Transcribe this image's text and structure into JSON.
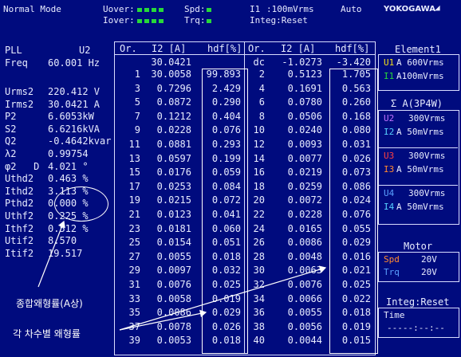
{
  "header": {
    "mode": "Normal Mode",
    "uover": "Uover:",
    "iover": "Iover:",
    "spd": "Spd:",
    "trq": "Trq:",
    "i1": "I1",
    "range": ":100mVrms",
    "auto": "Auto",
    "brand": "YOKOGAWA",
    "integ": "Integ:Reset"
  },
  "left": {
    "pll": "PLL",
    "pll_val": "U2",
    "freq": "Freq",
    "freq_val": "60.001 Hz",
    "rows": [
      {
        "label": "Urms2",
        "value": "220.412 V"
      },
      {
        "label": "Irms2",
        "value": "30.0421 A"
      },
      {
        "label": "P2",
        "value": "6.6053kW"
      },
      {
        "label": "S2",
        "value": "6.6216kVA"
      },
      {
        "label": "Q2",
        "value": "-0.4642kvar"
      },
      {
        "label": "λ2",
        "value": "0.99754"
      },
      {
        "label": "φ2   D",
        "value": "4.021 °"
      },
      {
        "label": "Uthd2",
        "value": "0.463 %"
      },
      {
        "label": "Ithd2",
        "value": "3.113 %"
      },
      {
        "label": "Pthd2",
        "value": "0.000 %"
      },
      {
        "label": "Uthf2",
        "value": "0.225 %"
      },
      {
        "label": "Ithf2",
        "value": "0.512 %"
      },
      {
        "label": "Utif2",
        "value": "8.570"
      },
      {
        "label": "Itif2",
        "value": "19.517"
      }
    ]
  },
  "table": {
    "headers": [
      "Or.",
      "I2 [A]",
      "hdf[%]",
      "Or.",
      "I2 [A]",
      "hdf[%]"
    ],
    "total_row": {
      "or1": "",
      "i1": "30.0421",
      "h1": "",
      "or2": "dc",
      "i2": "-1.0273",
      "h2": "-3.420"
    },
    "rows": [
      [
        "1",
        "30.0058",
        "99.893",
        "2",
        "0.5123",
        "1.705"
      ],
      [
        "3",
        "0.7296",
        "2.429",
        "4",
        "0.1691",
        "0.563"
      ],
      [
        "5",
        "0.0872",
        "0.290",
        "6",
        "0.0780",
        "0.260"
      ],
      [
        "7",
        "0.1212",
        "0.404",
        "8",
        "0.0506",
        "0.168"
      ],
      [
        "9",
        "0.0228",
        "0.076",
        "10",
        "0.0240",
        "0.080"
      ],
      [
        "11",
        "0.0881",
        "0.293",
        "12",
        "0.0093",
        "0.031"
      ],
      [
        "13",
        "0.0597",
        "0.199",
        "14",
        "0.0077",
        "0.026"
      ],
      [
        "15",
        "0.0176",
        "0.059",
        "16",
        "0.0219",
        "0.073"
      ],
      [
        "17",
        "0.0253",
        "0.084",
        "18",
        "0.0259",
        "0.086"
      ],
      [
        "19",
        "0.0215",
        "0.072",
        "20",
        "0.0072",
        "0.024"
      ],
      [
        "21",
        "0.0123",
        "0.041",
        "22",
        "0.0228",
        "0.076"
      ],
      [
        "23",
        "0.0181",
        "0.060",
        "24",
        "0.0165",
        "0.055"
      ],
      [
        "25",
        "0.0154",
        "0.051",
        "26",
        "0.0086",
        "0.029"
      ],
      [
        "27",
        "0.0055",
        "0.018",
        "28",
        "0.0048",
        "0.016"
      ],
      [
        "29",
        "0.0097",
        "0.032",
        "30",
        "0.0063",
        "0.021"
      ],
      [
        "31",
        "0.0076",
        "0.025",
        "32",
        "0.0076",
        "0.025"
      ],
      [
        "33",
        "0.0058",
        "0.019",
        "34",
        "0.0066",
        "0.022"
      ],
      [
        "35",
        "0.0086",
        "0.029",
        "36",
        "0.0055",
        "0.018"
      ],
      [
        "37",
        "0.0078",
        "0.026",
        "38",
        "0.0056",
        "0.019"
      ],
      [
        "39",
        "0.0053",
        "0.018",
        "40",
        "0.0044",
        "0.015"
      ]
    ]
  },
  "element1": {
    "title": "Element1",
    "u1_name": "U1",
    "u1_range": "A 600Vrms",
    "i1_name": "I1",
    "i1_range": "A100mVrms"
  },
  "sigma": {
    "title": "Σ A(3P4W)",
    "entries": [
      {
        "u": "U2",
        "u_range": "300Vrms",
        "i": "I2",
        "i_range": "A 50mVrms"
      },
      {
        "u": "U3",
        "u_range": "300Vrms",
        "i": "I3",
        "i_range": "A 50mVrms"
      },
      {
        "u": "U4",
        "u_range": "300Vrms",
        "i": "I4",
        "i_range": "A 50mVrms"
      }
    ]
  },
  "motor": {
    "title": "Motor",
    "spd": "Spd",
    "spd_val": "20V",
    "trq": "Trq",
    "trq_val": "20V"
  },
  "integ": {
    "title": "Integ:Reset",
    "time_label": "Time",
    "time_val": "-----:--:--"
  },
  "annotations": {
    "total_thd": "종합왜형률(A상)",
    "per_order": "각 차수별 왜형률"
  },
  "colors": {
    "background": "#000b7e",
    "green": "#27d83a",
    "yellow": "#f2e01a",
    "purple": "#c070ff",
    "cyan": "#55d0ff",
    "red": "#ff4040",
    "orange": "#ff8a30",
    "blue": "#5aa0ff"
  }
}
